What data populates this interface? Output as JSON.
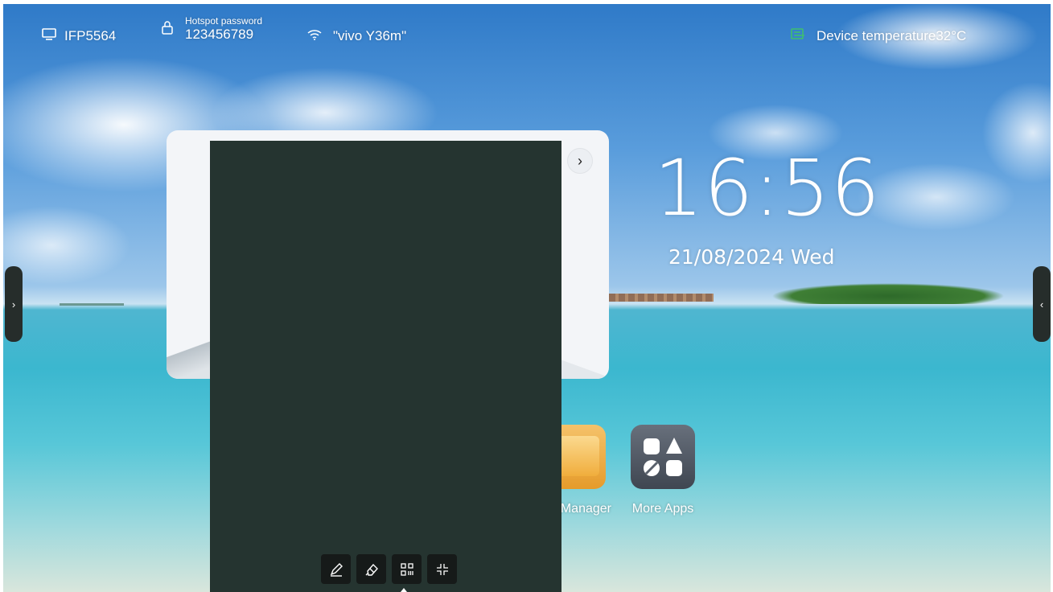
{
  "status_bar": {
    "device_name": "IFP5564",
    "hotspot_label": "Hotspot password",
    "hotspot_password": "123456789",
    "wifi_name": "\"vivo Y36m\"",
    "temperature_text": "Device temperature32°C",
    "icons": [
      "screen-icon",
      "lock-icon",
      "wifi-icon",
      "temperature-icon"
    ],
    "temperature_icon_color": "#3fbf6f"
  },
  "clock": {
    "time": "16:56",
    "date": "21/08/2024 Wed"
  },
  "side_handles": {
    "left_glyph": "›",
    "right_glyph": "‹"
  },
  "widget": {
    "next_glyph": "›"
  },
  "apps": [
    {
      "label": "Manager",
      "icon": "folder-icon"
    },
    {
      "label": "More Apps",
      "icon": "more-apps-icon"
    }
  ],
  "whiteboard": {
    "background_color": "#253430",
    "tools": [
      "pen-icon",
      "eraser-icon",
      "qr-code-icon",
      "exit-fullscreen-icon"
    ]
  }
}
